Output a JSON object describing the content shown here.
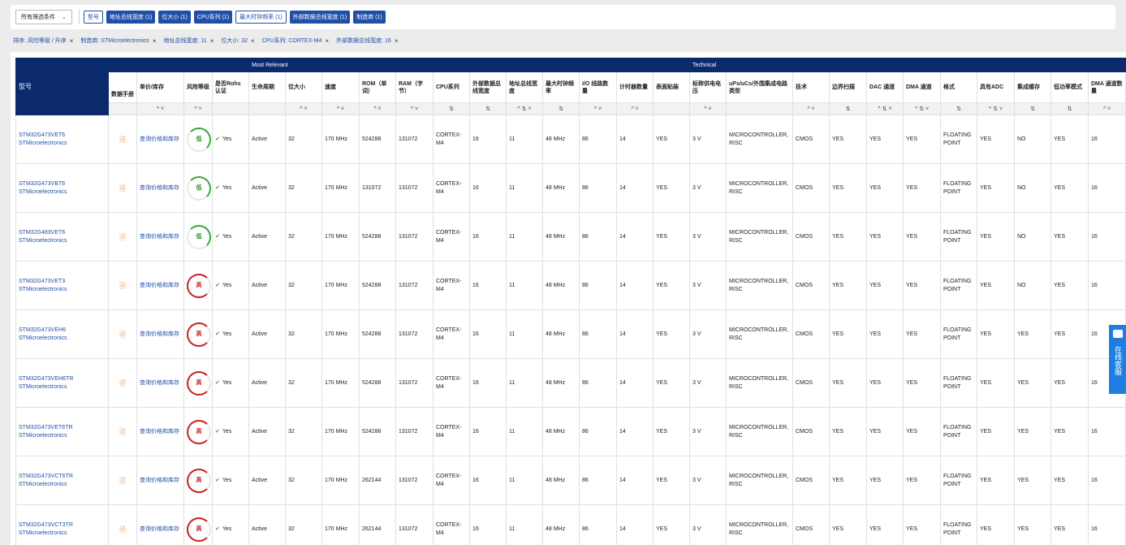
{
  "toolbar": {
    "filter_dropdown": "所有筛选条件",
    "chips": [
      {
        "label": "型号",
        "style": "outline"
      },
      {
        "label": "地址总线宽度 (1)",
        "style": "filled"
      },
      {
        "label": "位大小 (1)",
        "style": "filled"
      },
      {
        "label": "CPU系列 (1)",
        "style": "filled"
      },
      {
        "label": "最大时钟频率 (1)",
        "style": "outline"
      },
      {
        "label": "外部数据总线宽度 (1)",
        "style": "filled"
      },
      {
        "label": "制造商 (1)",
        "style": "filled"
      }
    ]
  },
  "active_filters": [
    "排序: 风险等级 / 升序",
    "制造商: STMicroelectronics",
    "地址总线宽度: 11",
    "位大小: 32",
    "CPU系列: CORTEX-M4",
    "外部数据总线宽度: 16"
  ],
  "table": {
    "pn_header": "型号",
    "group_most_relevant": "Most Relevant",
    "group_technical": "Technical",
    "columns": [
      "数据手册",
      "单价/库存",
      "风险等级",
      "是否Rohs认证",
      "生命周期",
      "位大小",
      "速度",
      "ROM（单词）",
      "RAM（字节）",
      "CPU系列",
      "外部数据总线宽度",
      "地址总线宽度",
      "最大时钟频率",
      "I/O 线路数量",
      "计时器数量",
      "表面贴装",
      "标称供电电压",
      "uPs/uCs/外围集成电路类型",
      "技术",
      "边界扫描",
      "DAC 通道",
      "DMA 通道",
      "格式",
      "具有ADC",
      "集成缓存",
      "低功率模式",
      "DMA 通道数量"
    ],
    "sort_controls": [
      "",
      "^ ˅",
      "^ ˅",
      "",
      "",
      "^ ˅",
      "^ ˅",
      "^ ˅",
      "^ ˅",
      "⇅",
      "⇅",
      "^ ⇅ ˅",
      "⇅",
      "^ ˅",
      "^ ˅",
      "",
      "^ ˅",
      "",
      "^ ˅",
      "⇅",
      "^ ⇅ ˅",
      "^ ⇅ ˅",
      "⇅",
      "^ ⇅ ˅",
      "⇅",
      "⇅",
      "^ ˅"
    ],
    "rows": [
      {
        "pn": "STM32G473VET6",
        "mfr": "STMicroelectronics",
        "price": "查询价格和库存",
        "risk": "低",
        "risk_level": "low",
        "rohs": "Yes",
        "life": "Active",
        "bits": "32",
        "speed": "170 MHz",
        "rom": "524288",
        "ram": "131072",
        "cpu": "CORTEX-M4",
        "extbus": "16",
        "addr": "11",
        "clock": "48 MHz",
        "io": "86",
        "timers": "14",
        "smd": "YES",
        "vcc": "3 V",
        "type": "MICROCONTROLLER, RISC",
        "tech": "CMOS",
        "bscan": "YES",
        "dac": "YES",
        "dma": "YES",
        "fmt": "FLOATING POINT",
        "adc": "YES",
        "cache": "NO",
        "lowpow": "YES",
        "dmach": "16"
      },
      {
        "pn": "STM32G473VBT6",
        "mfr": "STMicroelectronics",
        "price": "查询价格和库存",
        "risk": "低",
        "risk_level": "low",
        "rohs": "Yes",
        "life": "Active",
        "bits": "32",
        "speed": "170 MHz",
        "rom": "131072",
        "ram": "131072",
        "cpu": "CORTEX-M4",
        "extbus": "16",
        "addr": "11",
        "clock": "48 MHz",
        "io": "86",
        "timers": "14",
        "smd": "YES",
        "vcc": "3 V",
        "type": "MICROCONTROLLER, RISC",
        "tech": "CMOS",
        "bscan": "YES",
        "dac": "YES",
        "dma": "YES",
        "fmt": "FLOATING POINT",
        "adc": "YES",
        "cache": "NO",
        "lowpow": "YES",
        "dmach": "16"
      },
      {
        "pn": "STM32G483VET6",
        "mfr": "STMicroelectronics",
        "price": "查询价格和库存",
        "risk": "低",
        "risk_level": "low",
        "rohs": "Yes",
        "life": "Active",
        "bits": "32",
        "speed": "170 MHz",
        "rom": "524288",
        "ram": "131072",
        "cpu": "CORTEX-M4",
        "extbus": "16",
        "addr": "11",
        "clock": "48 MHz",
        "io": "86",
        "timers": "14",
        "smd": "YES",
        "vcc": "3 V",
        "type": "MICROCONTROLLER, RISC",
        "tech": "CMOS",
        "bscan": "YES",
        "dac": "YES",
        "dma": "YES",
        "fmt": "FLOATING POINT",
        "adc": "YES",
        "cache": "NO",
        "lowpow": "YES",
        "dmach": "16"
      },
      {
        "pn": "STM32G473VET3",
        "mfr": "STMicroelectronics",
        "price": "查询价格和库存",
        "risk": "高",
        "risk_level": "high",
        "rohs": "Yes",
        "life": "Active",
        "bits": "32",
        "speed": "170 MHz",
        "rom": "524288",
        "ram": "131072",
        "cpu": "CORTEX-M4",
        "extbus": "16",
        "addr": "11",
        "clock": "48 MHz",
        "io": "86",
        "timers": "14",
        "smd": "YES",
        "vcc": "3 V",
        "type": "MICROCONTROLLER, RISC",
        "tech": "CMOS",
        "bscan": "YES",
        "dac": "YES",
        "dma": "YES",
        "fmt": "FLOATING POINT",
        "adc": "YES",
        "cache": "NO",
        "lowpow": "YES",
        "dmach": "16"
      },
      {
        "pn": "STM32G473VEH6",
        "mfr": "STMicroelectronics",
        "price": "查询价格和库存",
        "risk": "高",
        "risk_level": "high",
        "rohs": "Yes",
        "life": "Active",
        "bits": "32",
        "speed": "170 MHz",
        "rom": "524288",
        "ram": "131072",
        "cpu": "CORTEX-M4",
        "extbus": "16",
        "addr": "11",
        "clock": "48 MHz",
        "io": "86",
        "timers": "14",
        "smd": "YES",
        "vcc": "3 V",
        "type": "MICROCONTROLLER, RISC",
        "tech": "CMOS",
        "bscan": "YES",
        "dac": "YES",
        "dma": "YES",
        "fmt": "FLOATING POINT",
        "adc": "YES",
        "cache": "YES",
        "lowpow": "YES",
        "dmach": "16"
      },
      {
        "pn": "STM32G473VEH6TR",
        "mfr": "STMicroelectronics",
        "price": "查询价格和库存",
        "risk": "高",
        "risk_level": "high",
        "rohs": "Yes",
        "life": "Active",
        "bits": "32",
        "speed": "170 MHz",
        "rom": "524288",
        "ram": "131072",
        "cpu": "CORTEX-M4",
        "extbus": "16",
        "addr": "11",
        "clock": "48 MHz",
        "io": "86",
        "timers": "14",
        "smd": "YES",
        "vcc": "3 V",
        "type": "MICROCONTROLLER, RISC",
        "tech": "CMOS",
        "bscan": "YES",
        "dac": "YES",
        "dma": "YES",
        "fmt": "FLOATING POINT",
        "adc": "YES",
        "cache": "YES",
        "lowpow": "YES",
        "dmach": "16"
      },
      {
        "pn": "STM32G473VET6TR",
        "mfr": "STMicroelectronics",
        "price": "查询价格和库存",
        "risk": "高",
        "risk_level": "high",
        "rohs": "Yes",
        "life": "Active",
        "bits": "32",
        "speed": "170 MHz",
        "rom": "524288",
        "ram": "131072",
        "cpu": "CORTEX-M4",
        "extbus": "16",
        "addr": "11",
        "clock": "48 MHz",
        "io": "86",
        "timers": "14",
        "smd": "YES",
        "vcc": "3 V",
        "type": "MICROCONTROLLER, RISC",
        "tech": "CMOS",
        "bscan": "YES",
        "dac": "YES",
        "dma": "YES",
        "fmt": "FLOATING POINT",
        "adc": "YES",
        "cache": "YES",
        "lowpow": "YES",
        "dmach": "16"
      },
      {
        "pn": "STM32G473VCT6TR",
        "mfr": "STMicroelectronics",
        "price": "查询价格和库存",
        "risk": "高",
        "risk_level": "high",
        "rohs": "Yes",
        "life": "Active",
        "bits": "32",
        "speed": "170 MHz",
        "rom": "262144",
        "ram": "131072",
        "cpu": "CORTEX-M4",
        "extbus": "16",
        "addr": "11",
        "clock": "48 MHz",
        "io": "86",
        "timers": "14",
        "smd": "YES",
        "vcc": "3 V",
        "type": "MICROCONTROLLER, RISC",
        "tech": "CMOS",
        "bscan": "YES",
        "dac": "YES",
        "dma": "YES",
        "fmt": "FLOATING POINT",
        "adc": "YES",
        "cache": "YES",
        "lowpow": "YES",
        "dmach": "16"
      },
      {
        "pn": "STM32G473VCT3TR",
        "mfr": "STMicroelectronics",
        "price": "查询价格和库存",
        "risk": "高",
        "risk_level": "high",
        "rohs": "Yes",
        "life": "Active",
        "bits": "32",
        "speed": "170 MHz",
        "rom": "262144",
        "ram": "131072",
        "cpu": "CORTEX-M4",
        "extbus": "16",
        "addr": "11",
        "clock": "48 MHz",
        "io": "86",
        "timers": "14",
        "smd": "YES",
        "vcc": "3 V",
        "type": "MICROCONTROLLER, RISC",
        "tech": "CMOS",
        "bscan": "YES",
        "dac": "YES",
        "dma": "YES",
        "fmt": "FLOATING POINT",
        "adc": "YES",
        "cache": "YES",
        "lowpow": "YES",
        "dmach": "16"
      }
    ]
  },
  "chat_widget": {
    "label": "在线客服",
    "icon": "chat-bubble-icon"
  },
  "colors": {
    "primary": "#1f4fa8",
    "header_bg": "#0a2a6c",
    "risk_low": "#3aa83a",
    "risk_high": "#c82020",
    "chat_bg": "#1f7fe0"
  }
}
